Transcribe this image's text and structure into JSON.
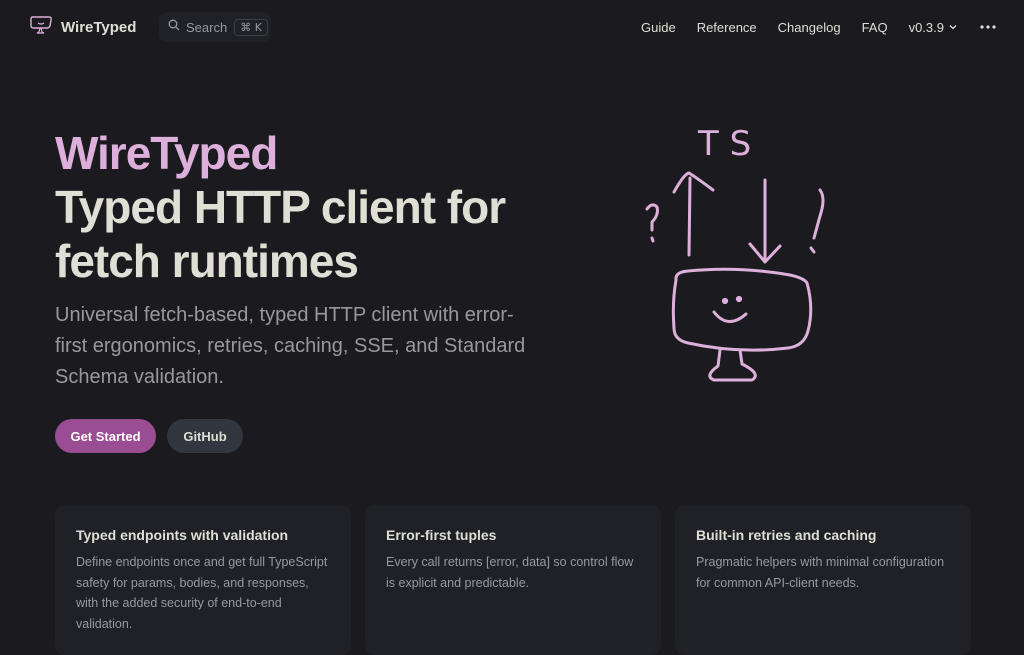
{
  "nav": {
    "brand": "WireTyped",
    "search": {
      "label": "Search",
      "shortcut": "⌘ K"
    },
    "links": [
      "Guide",
      "Reference",
      "Changelog",
      "FAQ"
    ],
    "version": "v0.3.9"
  },
  "hero": {
    "name": "WireTyped",
    "title": "Typed HTTP client for fetch runtimes",
    "tagline": "Universal fetch-based, typed HTTP client with error-first ergonomics, retries, caching, SSE, and Standard Schema validation.",
    "actions": {
      "primary": "Get Started",
      "secondary": "GitHub"
    },
    "image_text": "T S"
  },
  "features": [
    {
      "title": "Typed endpoints with validation",
      "details": "Define endpoints once and get full TypeScript safety for params, bodies, and responses, with the added security of end-to-end validation."
    },
    {
      "title": "Error-first tuples",
      "details": "Every call returns [error, data] so control flow is explicit and predictable."
    },
    {
      "title": "Built-in retries and caching",
      "details": "Pragmatic helpers with minimal configuration for common API-client needs."
    }
  ],
  "colors": {
    "background": "#1b1b1f",
    "brand": "#dcb0da",
    "button": "#9b4d93",
    "card": "#202127"
  }
}
